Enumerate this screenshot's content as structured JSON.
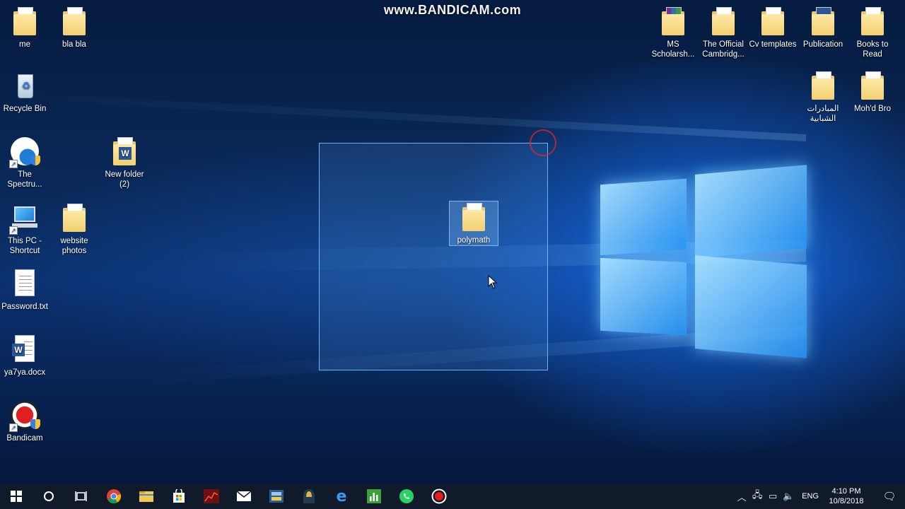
{
  "watermark": "www.BANDICAM.com",
  "desktop_icons_left": [
    {
      "label": "me",
      "type": "folder-pdf"
    },
    {
      "label": "bla bla",
      "type": "folder-pdf"
    },
    {
      "label": "Recycle Bin",
      "type": "recycle-bin"
    },
    {
      "label": "The Spectru...",
      "type": "app-shortcut"
    },
    {
      "label": "New folder (2)",
      "type": "folder-word"
    },
    {
      "label": "This PC - Shortcut",
      "type": "this-pc"
    },
    {
      "label": "website photos",
      "type": "folder"
    },
    {
      "label": "Password.txt",
      "type": "text-file"
    },
    {
      "label": "ya7ya.docx",
      "type": "word-doc"
    },
    {
      "label": "Bandicam",
      "type": "bandicam-shortcut"
    }
  ],
  "desktop_icons_right": [
    {
      "label": "MS Scholarsh...",
      "type": "folder-winrar"
    },
    {
      "label": "The Official Cambridg...",
      "type": "folder-pdf"
    },
    {
      "label": "Cv templates",
      "type": "folder"
    },
    {
      "label": "Publication",
      "type": "folder-word"
    },
    {
      "label": "Books to Read",
      "type": "folder-pdf"
    },
    {
      "label": "المبادرات الشبابية",
      "type": "folder"
    },
    {
      "label": "Moh'd Bro",
      "type": "folder"
    }
  ],
  "selected_item": {
    "label": "polymath",
    "type": "folder"
  },
  "taskbar": {
    "apps": [
      "start-icon",
      "cortana-icon",
      "task-view-icon",
      "chrome-icon",
      "file-explorer-icon",
      "store-icon",
      "stock-app-icon",
      "mail-icon",
      "cad-app-icon",
      "ghost-app-icon",
      "edge-icon",
      "charts-app-icon",
      "whatsapp-icon",
      "record-icon"
    ],
    "language": "ENG",
    "time": "4:10 PM",
    "date": "10/8/2018"
  },
  "colors": {
    "taskbar_bg": "#101a2a",
    "wallpaper_dark": "#061b3f",
    "wallpaper_glow": "#2896ff",
    "selection_border": "#78beff"
  }
}
